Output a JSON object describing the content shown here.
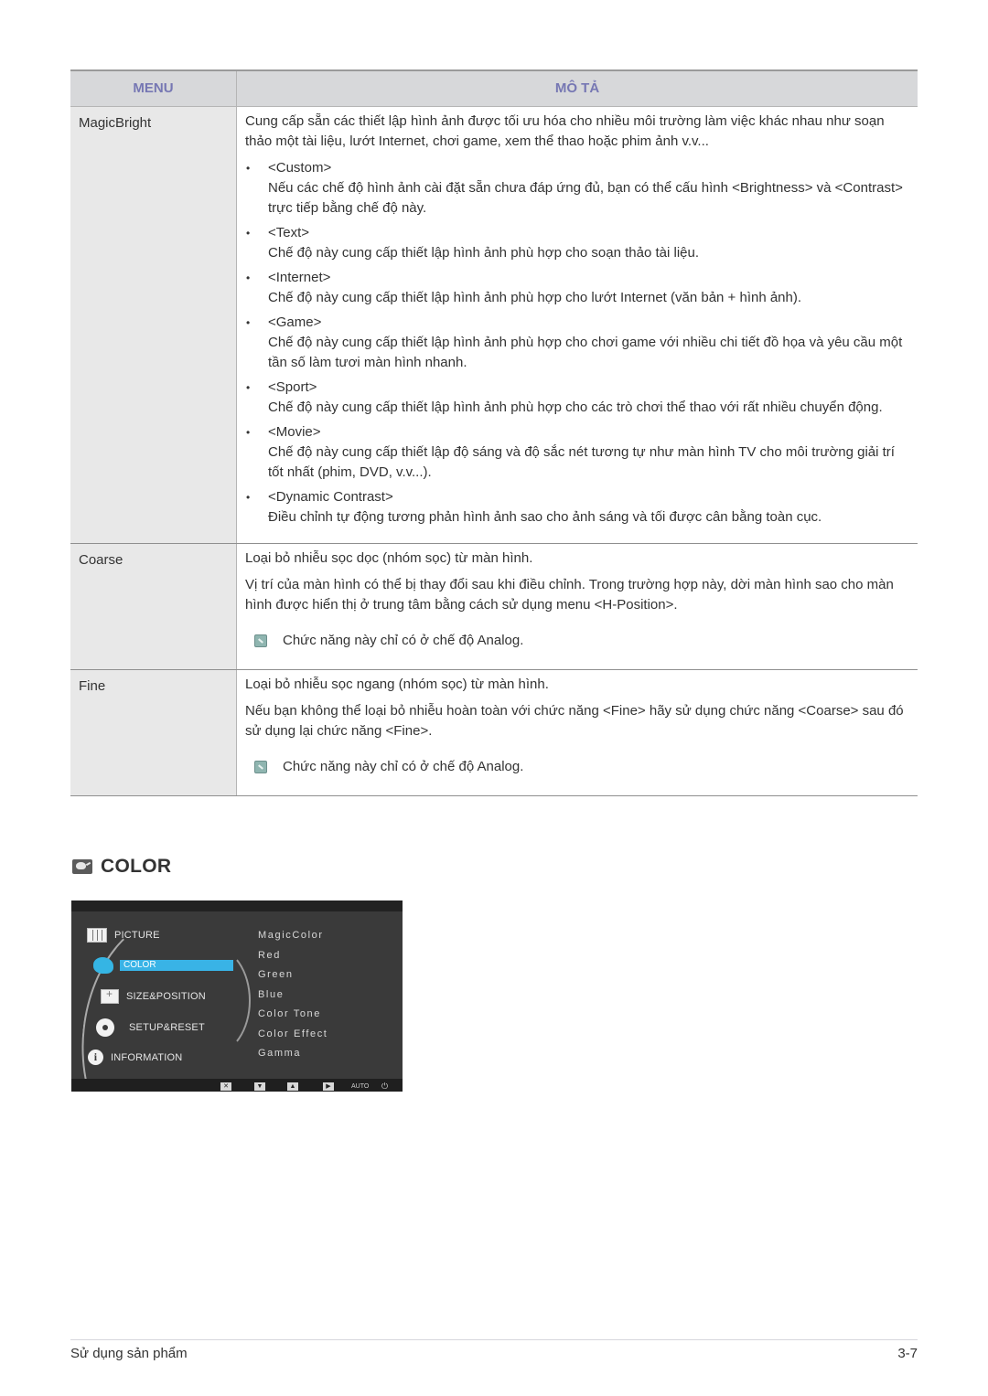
{
  "table": {
    "headers": {
      "menu": "MENU",
      "description": "MÔ TẢ"
    },
    "rows": [
      {
        "name": "MagicBright",
        "intro": "Cung cấp sẵn các thiết lập hình ảnh được tối ưu hóa cho nhiều môi trường làm việc khác nhau như soạn thảo một tài liệu, lướt Internet, chơi game, xem thể thao hoặc phim ảnh v.v...",
        "items": [
          {
            "title": "<Custom>",
            "text": "Nếu các chế độ hình ảnh cài đặt sẵn chưa đáp ứng đủ, bạn có thể cấu hình <Brightness> và <Contrast> trực tiếp bằng chế độ này."
          },
          {
            "title": "<Text>",
            "text": "Chế độ này cung cấp thiết lập hình ảnh phù hợp cho soạn thảo tài liệu."
          },
          {
            "title": "<Internet>",
            "text": "Chế độ này cung cấp thiết lập hình ảnh phù hợp cho lướt Internet (văn bản + hình ảnh)."
          },
          {
            "title": "<Game>",
            "text": "Chế độ này cung cấp thiết lập hình ảnh phù hợp cho chơi game với nhiều chi tiết đồ họa và yêu cầu một tần số làm tươi màn hình nhanh."
          },
          {
            "title": "<Sport>",
            "text": "Chế độ này cung cấp thiết lập hình ảnh phù hợp cho các trò chơi thể thao với rất nhiều chuyển động."
          },
          {
            "title": "<Movie>",
            "text": "Chế độ này cung cấp thiết lập độ sáng và độ sắc nét tương tự như màn hình TV cho môi trường giải trí tốt nhất (phim, DVD, v.v...)."
          },
          {
            "title": "<Dynamic Contrast>",
            "text": "Điều chỉnh tự động tương phản hình ảnh sao cho ảnh sáng và tối được cân bằng toàn cục."
          }
        ]
      },
      {
        "name": "Coarse",
        "para1": "Loại bỏ nhiễu sọc dọc (nhóm sọc) từ màn hình.",
        "para2": "Vị trí của màn hình có thể bị thay đổi sau khi điều chỉnh. Trong trường hợp này, dời màn hình sao cho màn hình được hiển thị ở trung tâm bằng cách sử dụng menu <H-Position>.",
        "note": "Chức năng này chỉ có ở chế độ Analog."
      },
      {
        "name": "Fine",
        "para1": "Loại bỏ nhiễu sọc ngang (nhóm sọc) từ màn hình.",
        "para2": "Nếu bạn không thể loại bỏ nhiễu hoàn toàn với chức năng <Fine> hãy sử dụng chức năng <Coarse> sau đó sử dụng lại chức năng <Fine>.",
        "note": "Chức năng này chỉ có ở chế độ Analog."
      }
    ]
  },
  "section": {
    "title": "COLOR",
    "icon": "color-palette-icon"
  },
  "osd": {
    "main_menu": [
      {
        "label": "PICTURE",
        "icon": "picture-icon"
      },
      {
        "label": "COLOR",
        "icon": "color-palette-icon",
        "selected": true
      },
      {
        "label": "SIZE&POSITION",
        "icon": "size-position-icon"
      },
      {
        "label": "SETUP&RESET",
        "icon": "gear-icon"
      },
      {
        "label": "INFORMATION",
        "icon": "info-icon"
      }
    ],
    "sub_menu": [
      "MagicColor",
      "Red",
      "Green",
      "Blue",
      "Color Tone",
      "Color Effect",
      "Gamma"
    ],
    "buttons": {
      "exit": "✕",
      "down": "▼",
      "up": "▲",
      "enter": "▶",
      "auto": "AUTO",
      "power": "⏻"
    },
    "accent": "#39b3e6"
  },
  "footer": {
    "left": "Sử dụng sản phẩm",
    "right": "3-7"
  }
}
